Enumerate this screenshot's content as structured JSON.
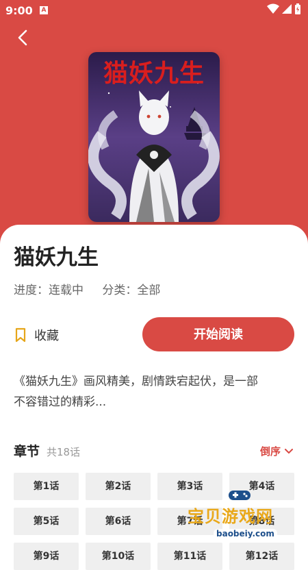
{
  "status": {
    "time": "9:00",
    "a_badge": "A"
  },
  "colors": {
    "accent": "#d94a44",
    "chapter_bg": "#efefef"
  },
  "book": {
    "cover_title": "猫妖九生",
    "title": "猫妖九生",
    "progress": "进度：连载中",
    "category": "分类：全部",
    "fav_label": "收藏",
    "read_label": "开始阅读",
    "description_line1": "《猫妖九生》画风精美，剧情跌宕起伏，是一部",
    "description_line2": "不容错过的精彩..."
  },
  "chapters": {
    "title": "章节",
    "count": "共18话",
    "order_label": "倒序",
    "items": [
      "第1话",
      "第2话",
      "第3话",
      "第4话",
      "第5话",
      "第6话",
      "第7话",
      "第8话",
      "第9话",
      "第10话",
      "第11话",
      "第12话"
    ]
  },
  "watermark": {
    "text": "宝贝游戏网",
    "url": "baobeiy.com"
  },
  "icons": {
    "back": "back-arrow-icon",
    "bookmark": "bookmark-icon",
    "order": "chevron-down-icon"
  }
}
